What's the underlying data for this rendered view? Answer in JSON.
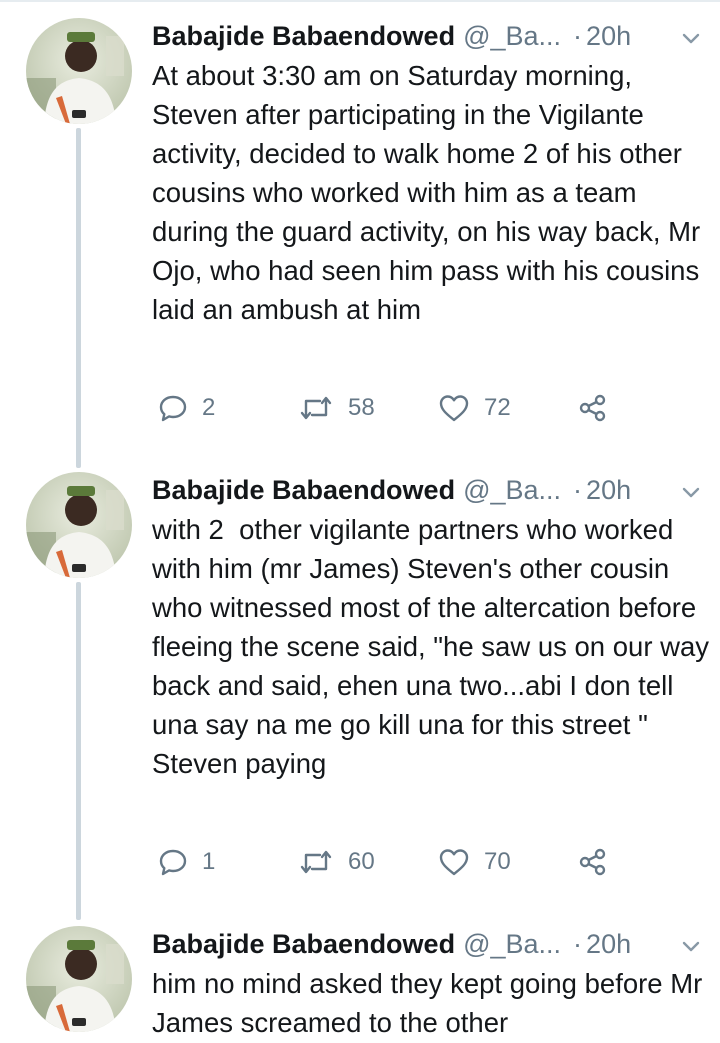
{
  "tweets": [
    {
      "author_name": "Babajide Babaendowed",
      "author_handle": "@_Ba...",
      "separator": "·",
      "time": "20h",
      "text": "At about 3:30 am on Saturday morning, Steven after participating in the Vigilante activity, decided to walk home 2 of his other cousins who worked with him as a team during the guard activity, on his way back, Mr Ojo, who had seen him pass with his cousins laid an ambush at him",
      "replies": "2",
      "retweets": "58",
      "likes": "72",
      "icons": [
        "reply-icon",
        "retweet-icon",
        "like-icon",
        "share-icon"
      ]
    },
    {
      "author_name": "Babajide Babaendowed",
      "author_handle": "@_Ba...",
      "separator": "·",
      "time": "20h",
      "text": "with 2  other vigilante partners who worked with him (mr James) Steven's other cousin who witnessed most of the altercation before fleeing the scene said, \"he saw us on our way back and said, ehen una two...abi I don tell una say na me go kill una for this street \" Steven paying",
      "replies": "1",
      "retweets": "60",
      "likes": "70",
      "icons": [
        "reply-icon",
        "retweet-icon",
        "like-icon",
        "share-icon"
      ]
    },
    {
      "author_name": "Babajide Babaendowed",
      "author_handle": "@_Ba...",
      "separator": "·",
      "time": "20h",
      "text": "him no mind asked they kept going before Mr James screamed to the other"
    }
  ],
  "colors": {
    "text": "#14171a",
    "secondary": "#657786",
    "thread_line": "#ccd6dd"
  }
}
